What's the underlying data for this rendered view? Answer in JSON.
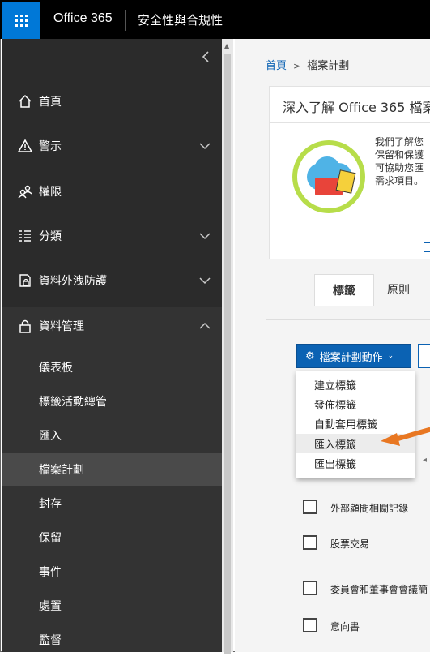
{
  "topbar": {
    "brand": "Office 365",
    "section": "安全性與合規性"
  },
  "sidebar": {
    "items": [
      {
        "label": "首頁",
        "icon": "home-icon"
      },
      {
        "label": "警示",
        "icon": "warning-icon"
      },
      {
        "label": "權限",
        "icon": "permissions-icon"
      },
      {
        "label": "分類",
        "icon": "classification-icon"
      },
      {
        "label": "資料外洩防護",
        "icon": "dlp-icon"
      },
      {
        "label": "資料管理",
        "icon": "lock-icon"
      }
    ],
    "sub_items": [
      "儀表板",
      "標籤活動總管",
      "匯入",
      "檔案計劃",
      "封存",
      "保留",
      "事件",
      "處置",
      "監督"
    ],
    "selected_sub_item": "檔案計劃"
  },
  "breadcrumb": {
    "home": "首頁",
    "current": "檔案計劃"
  },
  "card": {
    "title": "深入了解 Office 365 檔案",
    "lines": [
      "我們了解您",
      "保留和保護",
      "可協助您匯",
      "需求項目。"
    ]
  },
  "tabs": [
    "標籤",
    "原則"
  ],
  "action_button": {
    "label": "檔案計劃動作"
  },
  "dropdown": {
    "items": [
      "建立標籤",
      "發佈標籤",
      "自動套用標籤",
      "匯入標籤",
      "匯出標籤"
    ],
    "highlighted": "匯入標籤"
  },
  "labels_list": [
    "外部顧問相關記錄",
    "股票交易",
    "委員會和董事會會議簡",
    "意向書"
  ],
  "colors": {
    "accent": "#0078d7",
    "button_blue": "#0b62b3",
    "arrow": "#e87722",
    "sidebar_bg": "#2b2b2b"
  }
}
